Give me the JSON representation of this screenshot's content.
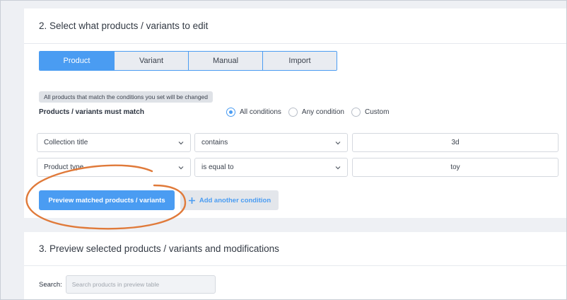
{
  "section2": {
    "title": "2. Select what products / variants to edit",
    "tabs": [
      "Product",
      "Variant",
      "Manual",
      "Import"
    ],
    "active_tab": 0,
    "hint": "All products that match the conditions you set will be changed",
    "match_label": "Products / variants must match",
    "match_options": [
      "All conditions",
      "Any condition",
      "Custom"
    ],
    "selected_match": 0,
    "conditions": [
      {
        "field": "Collection title",
        "operator": "contains",
        "value": "3d"
      },
      {
        "field": "Product type",
        "operator": "is equal to",
        "value": "toy"
      }
    ],
    "preview_button": "Preview matched products / variants",
    "add_condition_button": "Add another condition"
  },
  "section3": {
    "title": "3. Preview selected products / variants and modifications",
    "search_label": "Search:",
    "search_placeholder": "Search products in preview table"
  },
  "colors": {
    "accent": "#4a9cf2",
    "highlight": "#e07a3a"
  }
}
